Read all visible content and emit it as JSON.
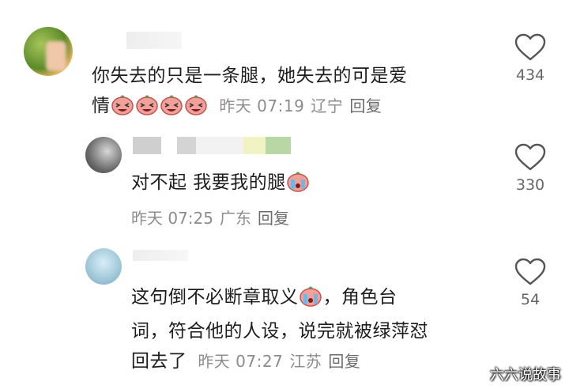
{
  "comments": [
    {
      "text_line1": "你失去的只是一条腿，她失去的可是爱",
      "text_line2": "情",
      "emojis": [
        "laughing-face-emoji",
        "laughing-face-emoji",
        "laughing-face-emoji",
        "laughing-face-emoji"
      ],
      "time": "昨天 07:19",
      "location": "辽宁",
      "reply_label": "回复",
      "likes": "434"
    },
    {
      "text_line1": "对不起 我要我的腿",
      "emojis": [
        "crying-face-emoji"
      ],
      "time": "昨天 07:25",
      "location": "广东",
      "reply_label": "回复",
      "likes": "330"
    },
    {
      "text_line1": "这句倒不必断章取义",
      "text_line1b": "，角色台",
      "text_line2": "词，符合他的人设，说完就被绿萍怼",
      "text_line3": "回去了",
      "emojis": [
        "crying-face-emoji"
      ],
      "time": "昨天 07:27",
      "location": "江苏",
      "reply_label": "回复",
      "likes": "54"
    }
  ],
  "icons": {
    "like": "heart-outline-icon"
  },
  "watermark": "六六说故事",
  "colors": {
    "meta": "#8c8c8c",
    "text": "#1d1d1d",
    "icon": "#555555"
  }
}
